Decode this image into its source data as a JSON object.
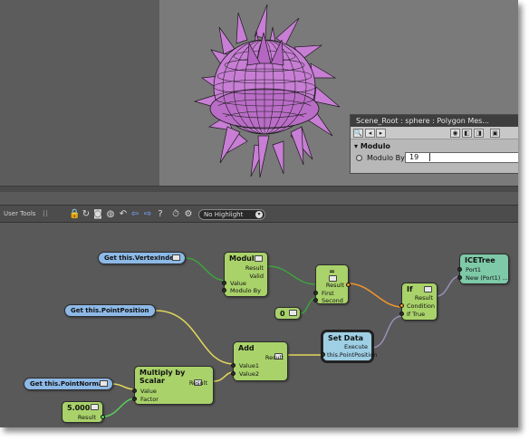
{
  "ppg": {
    "title": "Scene_Root : sphere : Polygon Mes...",
    "section": "Modulo",
    "param_label": "Modulo By",
    "param_value": "19",
    "slider_fraction": 0.21
  },
  "toolbar": {
    "user_tools": "User Tools",
    "highlight": "No Highlight"
  },
  "nodes": {
    "get_vertex": "Get this.VertexIndex",
    "get_pointpos": "Get this.PointPosition",
    "get_pointnormal": "Get this.PointNormal",
    "modulo": {
      "title": "Modulo",
      "out1": "Result",
      "out2": "Valid",
      "in1": "Value",
      "in2": "Modulo By"
    },
    "equal": {
      "title": "=",
      "out": "Result",
      "in1": "First",
      "in2": "Second"
    },
    "zero": {
      "value": "0"
    },
    "if": {
      "title": "If",
      "out": "Result",
      "in1": "Condition",
      "in2": "If True"
    },
    "icetree": {
      "title": "ICETree",
      "in1": "Port1",
      "in2": "New (Port1) ..."
    },
    "setdata": {
      "title": "Set Data",
      "out": "Execute",
      "in1": "this.PointPosition"
    },
    "add": {
      "title": "Add",
      "out": "Result",
      "in1": "Value1",
      "in2": "Value2"
    },
    "multiply": {
      "title": "Multiply by Scalar",
      "out": "Result",
      "in1": "Value",
      "in2": "Factor"
    },
    "scalar": {
      "value": "5.000",
      "out": "Result"
    }
  },
  "colors": {
    "node_green": "#a9d26a",
    "node_blue": "#8db9e6",
    "node_cyan": "#9ecfe4",
    "node_teal": "#7ec9a8",
    "mesh_purple": "#c77ed4",
    "wire_orange": "#f0962c",
    "wire_yellow": "#e3d85a",
    "wire_green": "#3ea33e"
  }
}
